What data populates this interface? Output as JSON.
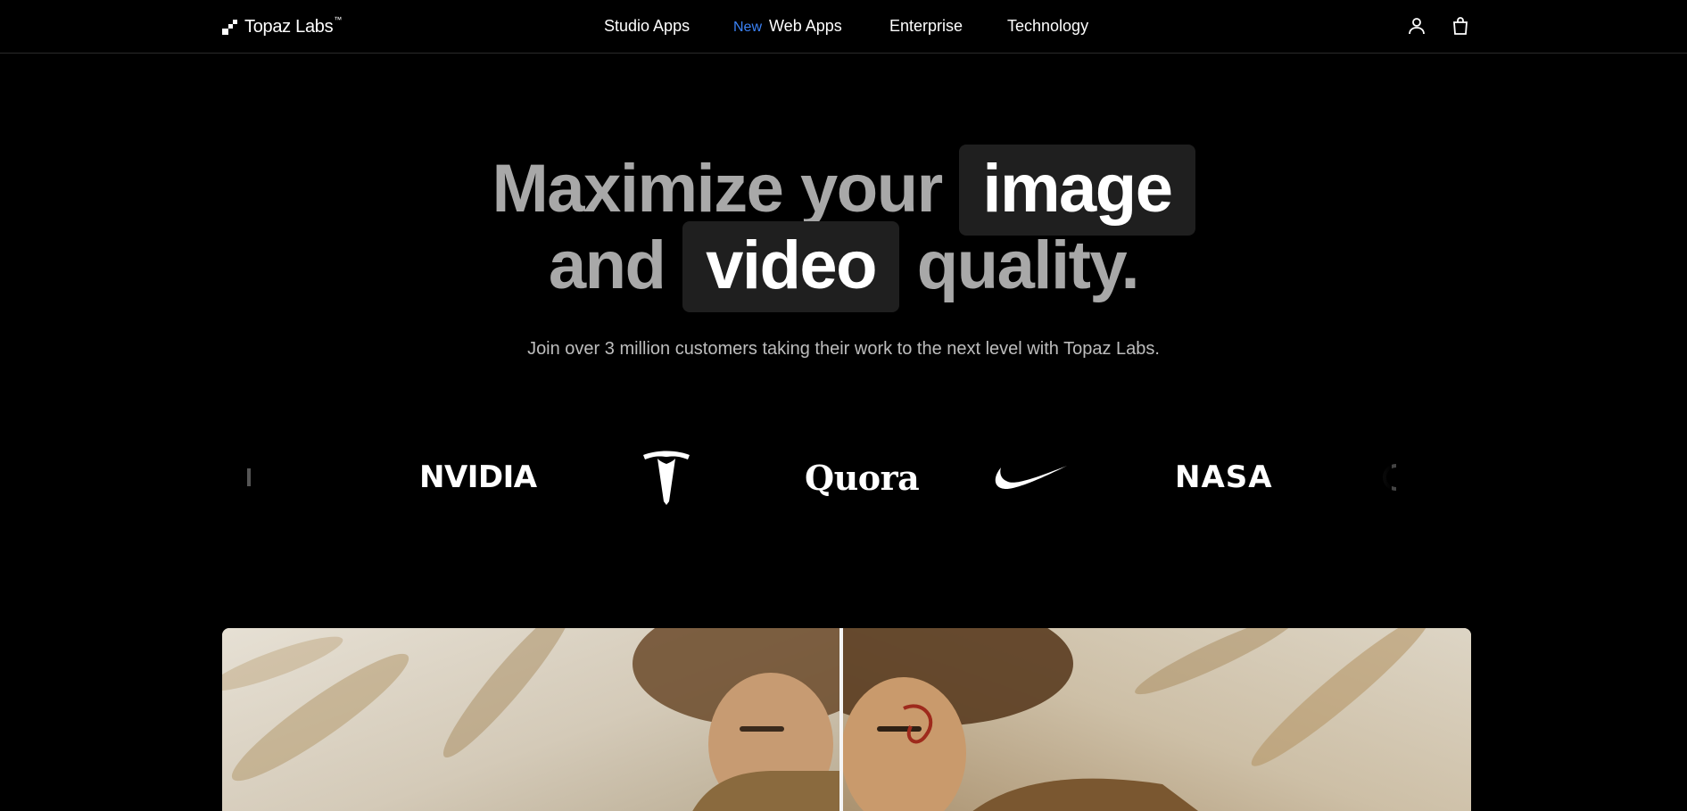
{
  "nav": {
    "brand": "Topaz Labs",
    "trademark": "™",
    "links": {
      "studio_apps": "Studio Apps",
      "new_badge": "New",
      "web_apps": "Web Apps",
      "enterprise": "Enterprise",
      "technology": "Technology"
    },
    "icons": [
      "user-icon",
      "shopping-bag-icon"
    ]
  },
  "hero": {
    "title_part1": "Maximize your",
    "title_pill1": "image",
    "title_part2": "and",
    "title_pill2": "video",
    "title_part3": "quality.",
    "subtitle": "Join over 3 million customers taking their work to the next level with Topaz Labs."
  },
  "brands": {
    "nvidia": "NVIDIA",
    "tesla": "tesla-logo",
    "quora": "Quora",
    "nike": "nike-swoosh-logo",
    "nasa": "NASA"
  },
  "colors": {
    "background": "#000000",
    "accent": "#3b82f6",
    "title_gray": "#a8a8a8",
    "pill_bg": "#1f1f1f"
  }
}
